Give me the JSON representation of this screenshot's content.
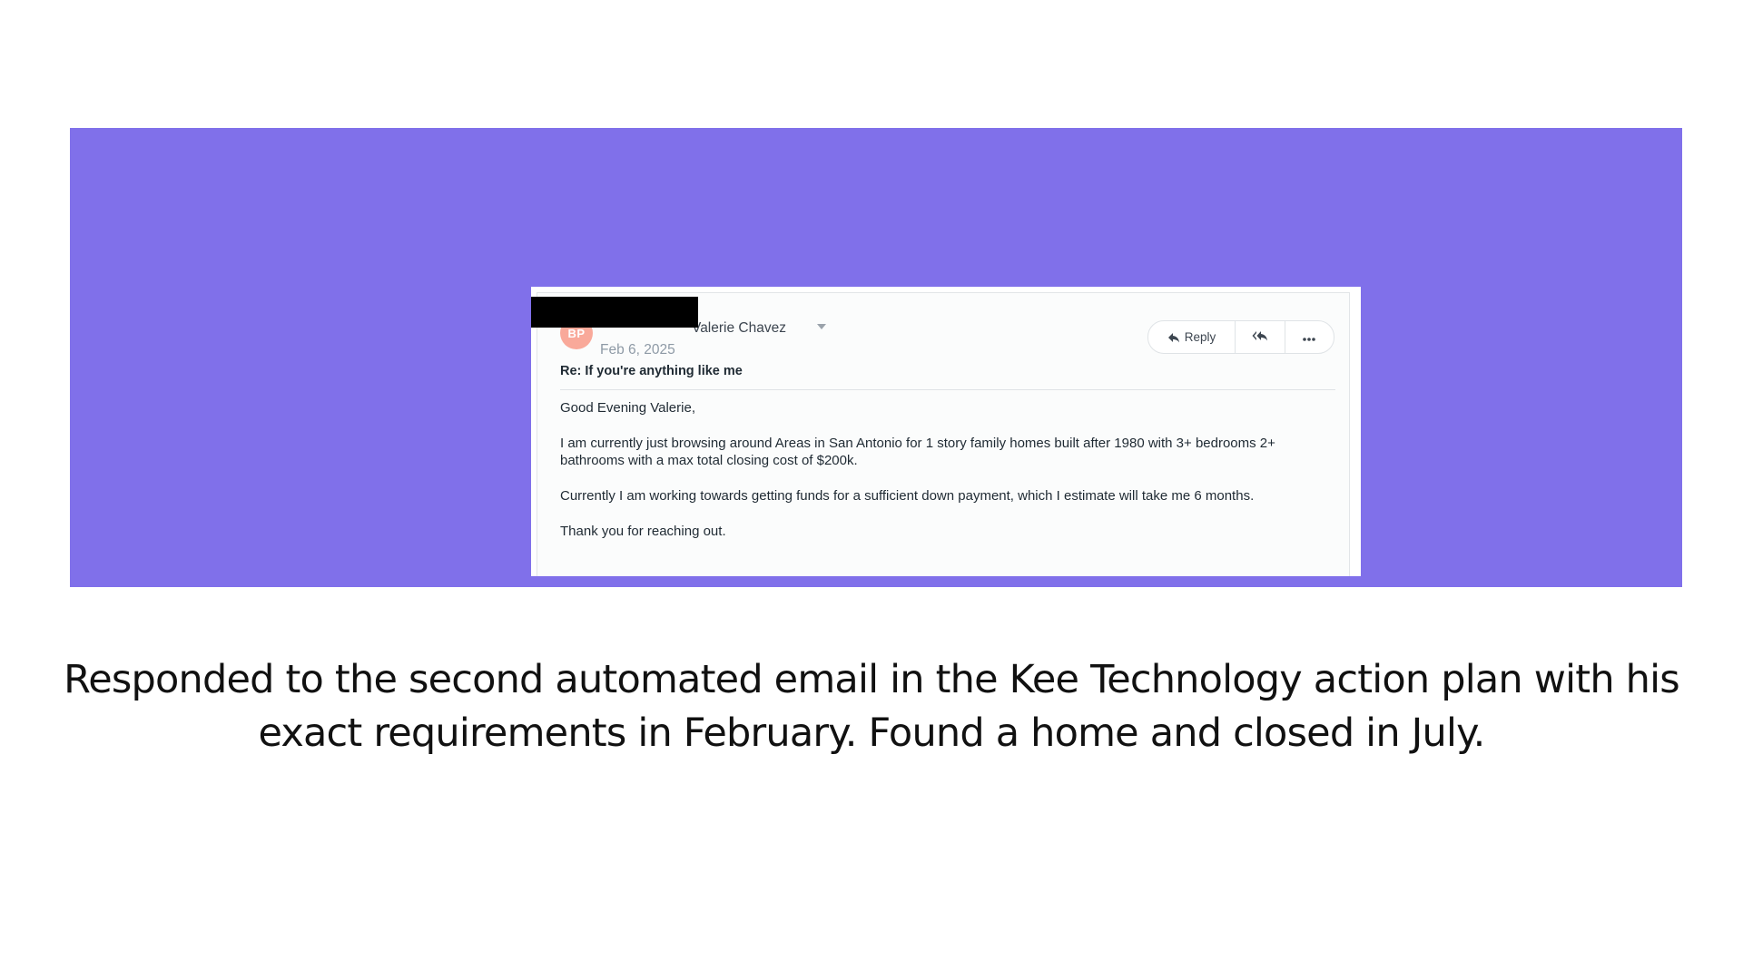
{
  "colors": {
    "banner_bg": "#8070ea",
    "avatar_bg": "#f9a99a",
    "redaction": "#000000"
  },
  "email": {
    "avatar_initials": "BP",
    "sender_name": "Valerie Chavez",
    "date": "Feb 6, 2025",
    "subject": "Re: If you're anything like me",
    "actions": {
      "reply_label": "Reply",
      "reply_icon": "reply-icon",
      "reply_all_icon": "reply-all-icon",
      "more_icon": "more-icon"
    },
    "body": {
      "greeting": "Good Evening Valerie,",
      "paragraph_1": "I am currently just browsing around Areas in San Antonio for 1 story family homes built after 1980 with 3+ bedrooms 2+ bathrooms with a max total closing cost of $200k.",
      "paragraph_2": "Currently I am working towards getting funds for a sufficient down payment, which I estimate will take me 6 months.",
      "closing": "Thank you for reaching out."
    }
  },
  "caption": {
    "text": "Responded to the second automated email in the Kee Technology action plan with his exact requirements in February. Found a home and closed in July."
  }
}
